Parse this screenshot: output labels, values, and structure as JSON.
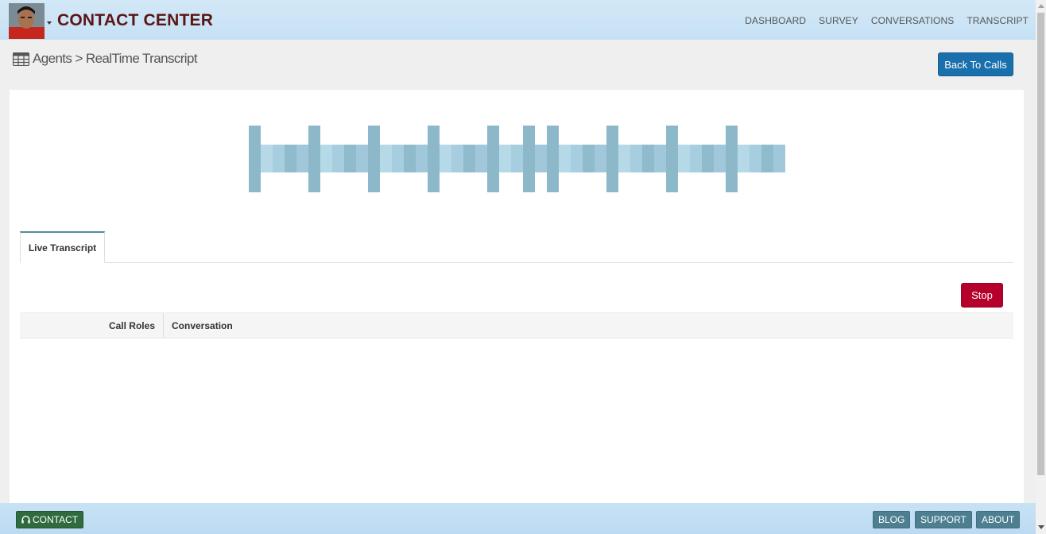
{
  "header": {
    "brand": "CONTACT CENTER",
    "nav": [
      "DASHBOARD",
      "SURVEY",
      "CONVERSATIONS",
      "TRANSCRIPT"
    ]
  },
  "breadcrumb": {
    "text": "Agents > RealTime Transcript"
  },
  "actions": {
    "back_label": "Back To Calls",
    "stop_label": "Stop"
  },
  "tabs": [
    {
      "label": "Live Transcript",
      "active": true
    }
  ],
  "table": {
    "columns": [
      "Call Roles",
      "Conversation"
    ],
    "rows": []
  },
  "footer": {
    "contact_label": "CONTACT",
    "links": [
      "BLOG",
      "SUPPORT",
      "ABOUT"
    ]
  },
  "colors": {
    "brand": "#5c1515",
    "primary_button": "#1a6fad",
    "stop_button": "#b5002c",
    "contact_button": "#2f6b3c",
    "footer_button": "#4d7f91"
  },
  "icons": {
    "breadcrumb": "table-icon",
    "contact": "headphones-icon"
  }
}
